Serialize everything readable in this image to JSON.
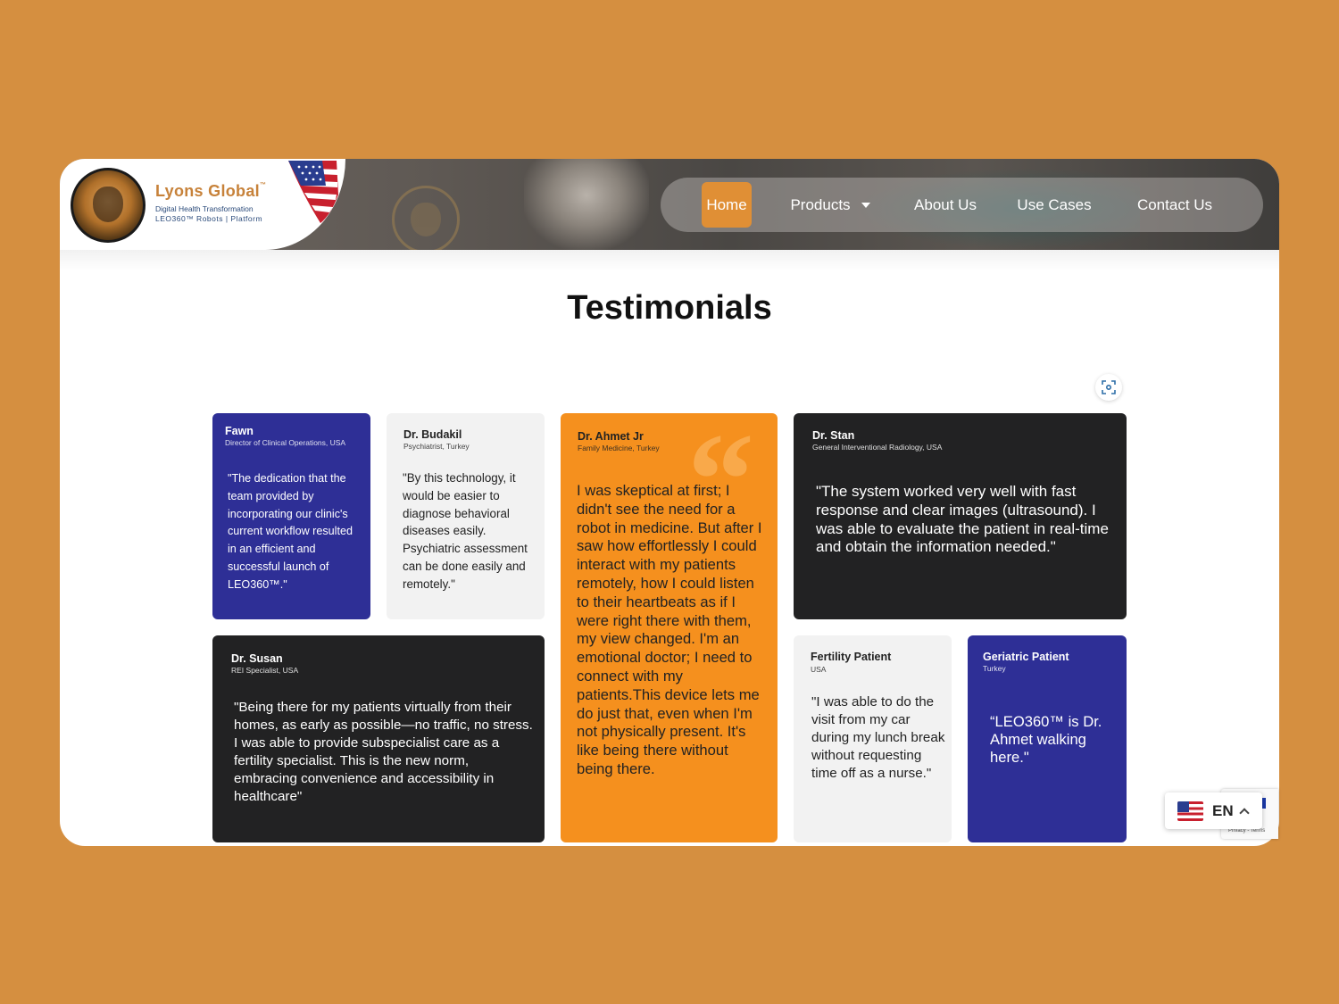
{
  "brand": {
    "name": "Lyons Global",
    "tagline": "Digital Health Transformation",
    "sub": "LEO360™ Robots | Platform"
  },
  "nav": {
    "items": [
      {
        "label": "Home",
        "active": true
      },
      {
        "label": "Products"
      },
      {
        "label": "About Us"
      },
      {
        "label": "Use Cases"
      },
      {
        "label": "Contact Us"
      }
    ]
  },
  "page": {
    "title": "Testimonials"
  },
  "testimonials": [
    {
      "name": "Fawn",
      "role": "Director of Clinical Operations, USA",
      "quote": "\"The dedication that the team provided by incorporating our clinic's current workflow resulted in an efficient and successful launch of LEO360™.\"",
      "color": "#2E2F96"
    },
    {
      "name": "Dr. Budakil",
      "role": "Psychiatrist, Turkey",
      "quote": "\"By this technology, it would be easier to diagnose behavioral diseases easily. Psychiatric assessment can be done easily and remotely.\"",
      "color": "#F2F2F2"
    },
    {
      "name": "Dr. Ahmet Jr",
      "role": "Family Medicine, Turkey",
      "quote": "I was skeptical at first; I didn't see the need for a robot in medicine. But after I saw how effortlessly I could interact with my patients remotely, how I could listen to their heartbeats as if I were right there with them, my view changed. I'm an emotional doctor; I need to connect with my patients.This device lets me do just that, even when I'm not physically present. It's like being there without being there.",
      "color": "#F5901E"
    },
    {
      "name": "Dr. Stan",
      "role": "General Interventional Radiology, USA",
      "quote": "\"The system worked very well with fast response and clear images (ultrasound). I was able to evaluate the patient in real-time and obtain the information needed.\"",
      "color": "#222223"
    },
    {
      "name": "Dr. Susan",
      "role": "REI Specialist, USA",
      "quote": "\"Being there for my patients virtually from their homes, as early as possible—no traffic, no stress. I was able to provide subspecialist care as a fertility specialist. This is the new norm, embracing convenience and accessibility in healthcare\"",
      "color": "#222223"
    },
    {
      "name": "Fertility Patient",
      "role": "USA",
      "quote": "\"I was able to do the visit from my car during my lunch break without requesting time off as a nurse.\"",
      "color": "#F2F2F2"
    },
    {
      "name": "Geriatric Patient",
      "role": "Turkey",
      "quote": "“LEO360™ is Dr. Ahmet walking here.\"",
      "color": "#2E2F96"
    }
  ],
  "language": {
    "code": "EN"
  },
  "recaptcha": {
    "text": "Privacy - Terms"
  },
  "colors": {
    "background": "#D58F40",
    "accent": "#E08F35",
    "purple": "#2E2F96",
    "dark": "#222223",
    "orange": "#F5901E"
  }
}
